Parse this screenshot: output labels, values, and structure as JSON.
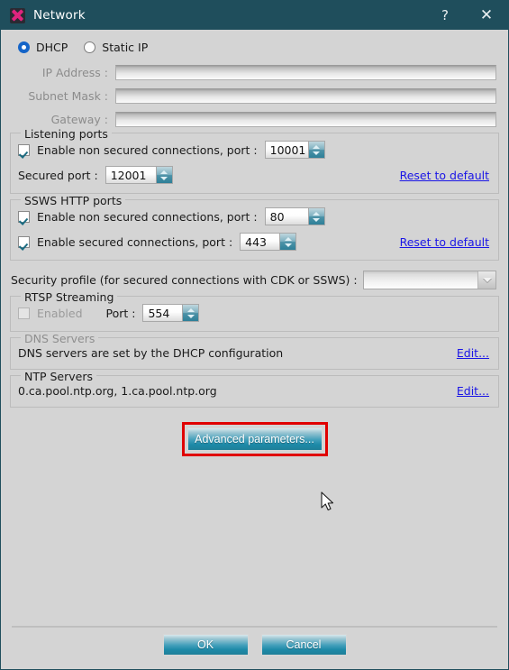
{
  "window": {
    "title": "Network",
    "icon": "app-network-icon",
    "help_label": "?",
    "close_label": "✕",
    "accent_titlebar": "#1f4e5c",
    "accent_button": "#1d8aa8",
    "highlight_color": "#e00000",
    "link_color": "#1a15e6"
  },
  "ip_mode": {
    "options": [
      {
        "label": "DHCP",
        "selected": true
      },
      {
        "label": "Static IP",
        "selected": false
      }
    ]
  },
  "static_ip": {
    "enabled": false,
    "fields": [
      {
        "label": "IP Address :",
        "value": "",
        "placeholder": ""
      },
      {
        "label": "Subnet Mask :",
        "value": "",
        "placeholder": ""
      },
      {
        "label": "Gateway :",
        "value": "",
        "placeholder": ""
      }
    ]
  },
  "listening_ports": {
    "legend": "Listening ports",
    "non_secured": {
      "checkbox_label": "Enable non secured connections, port :",
      "checked": true,
      "port": "10001"
    },
    "secured": {
      "label": "Secured port :",
      "port": "12001"
    },
    "reset_label": "Reset to default"
  },
  "ssws_http_ports": {
    "legend": "SSWS HTTP ports",
    "non_secured": {
      "checkbox_label": "Enable non secured connections, port :",
      "checked": true,
      "port": "80"
    },
    "secured": {
      "checkbox_label": "Enable secured connections, port :",
      "checked": true,
      "port": "443"
    },
    "reset_label": "Reset to default"
  },
  "security_profile": {
    "label": "Security profile (for secured connections with CDK or SSWS) :",
    "selected": "",
    "options": []
  },
  "rtsp_streaming": {
    "legend": "RTSP Streaming",
    "enabled_label": "Enabled",
    "enabled_checked": false,
    "enabled_disabled": true,
    "port_label": "Port :",
    "port": "554"
  },
  "dns_servers": {
    "legend": "DNS Servers",
    "disabled": true,
    "text": "DNS servers are set by the DHCP configuration",
    "edit_label": "Edit..."
  },
  "ntp_servers": {
    "legend": "NTP Servers",
    "text": "0.ca.pool.ntp.org, 1.ca.pool.ntp.org",
    "edit_label": "Edit..."
  },
  "advanced": {
    "button_label": "Advanced parameters...",
    "highlighted": true
  },
  "footer": {
    "ok_label": "OK",
    "cancel_label": "Cancel"
  }
}
